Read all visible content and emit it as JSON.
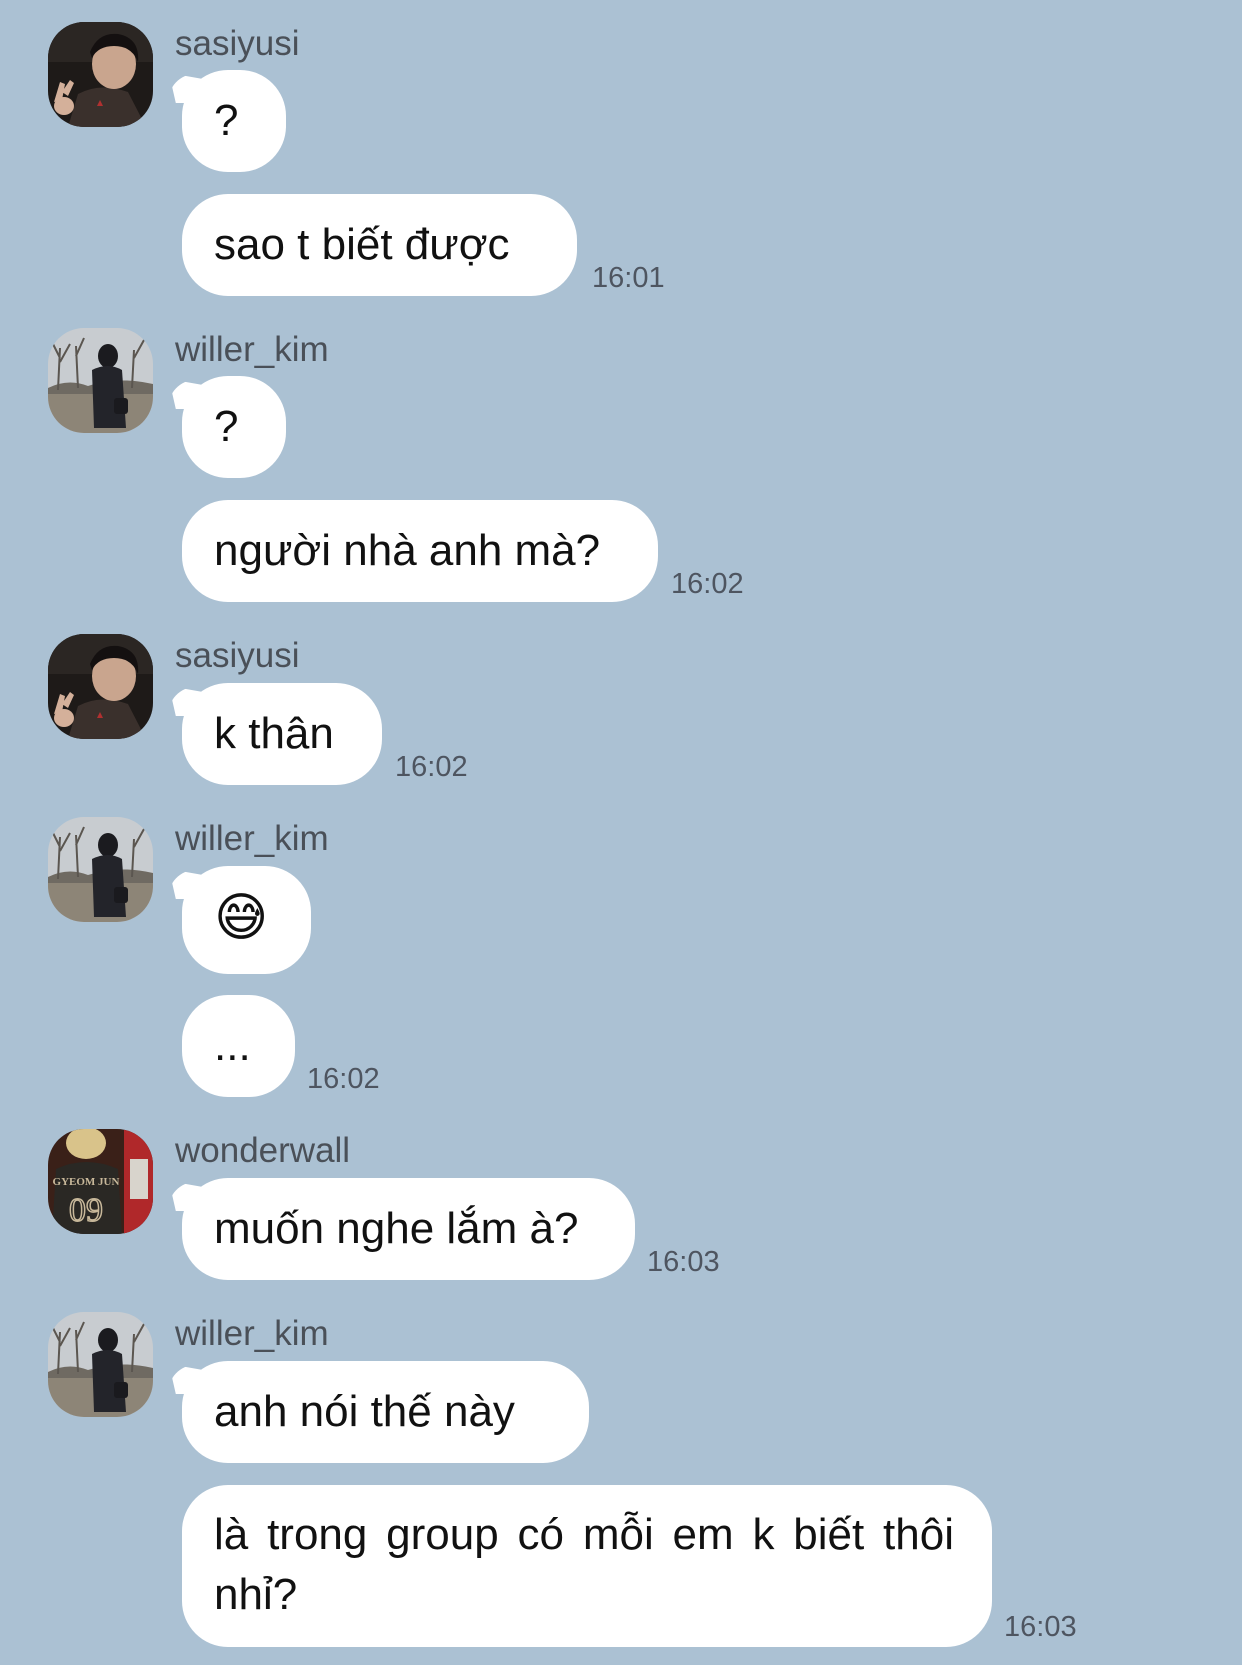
{
  "chat": {
    "messages": [
      {
        "sender": "sasiyusi",
        "bubbles": [
          "?",
          "sao t biết được"
        ],
        "time": "16:01"
      },
      {
        "sender": "willer_kim",
        "bubbles": [
          "?",
          "người nhà anh mà?"
        ],
        "time": "16:02"
      },
      {
        "sender": "sasiyusi",
        "bubbles": [
          "k thân"
        ],
        "time": "16:02"
      },
      {
        "sender": "willer_kim",
        "bubbles": [
          "😅",
          "..."
        ],
        "time": "16:02"
      },
      {
        "sender": "wonderwall",
        "bubbles": [
          "muốn nghe lắm à?"
        ],
        "time": "16:03"
      },
      {
        "sender": "willer_kim",
        "bubbles": [
          "anh nói thế này",
          "là trong group có mỗi em k biết thôi nhỉ?"
        ],
        "time": "16:03"
      }
    ]
  },
  "avatars": {
    "sasiyusi": "selfie-avatar-icon",
    "willer_kim": "park-walk-avatar-icon",
    "wonderwall": "jersey-avatar-icon"
  },
  "jersey_text": {
    "name": "GYEOM JUN",
    "number": "09"
  },
  "colors": {
    "background": "#abc1d3",
    "bubble": "#ffffff",
    "sender_text": "#4a5058",
    "time_text": "#4e5560"
  }
}
